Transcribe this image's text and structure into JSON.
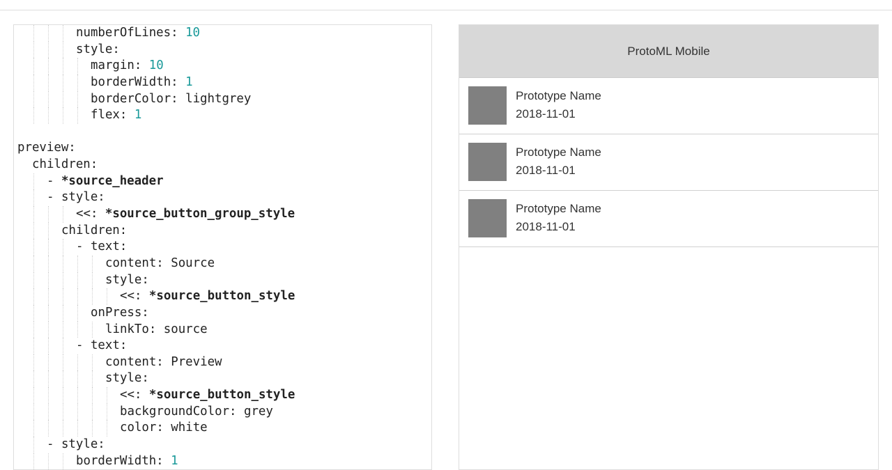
{
  "editor": {
    "lines": [
      {
        "indent": 4,
        "parts": [
          {
            "text": "numberOfLines: "
          },
          {
            "text": "10",
            "cls": "num"
          }
        ]
      },
      {
        "indent": 4,
        "parts": [
          {
            "text": "style:"
          }
        ]
      },
      {
        "indent": 5,
        "parts": [
          {
            "text": "margin: "
          },
          {
            "text": "10",
            "cls": "num"
          }
        ]
      },
      {
        "indent": 5,
        "parts": [
          {
            "text": "borderWidth: "
          },
          {
            "text": "1",
            "cls": "num"
          }
        ]
      },
      {
        "indent": 5,
        "parts": [
          {
            "text": "borderColor: lightgrey"
          }
        ]
      },
      {
        "indent": 5,
        "parts": [
          {
            "text": "flex: "
          },
          {
            "text": "1",
            "cls": "num"
          }
        ]
      },
      {
        "indent": 0,
        "parts": []
      },
      {
        "indent": 0,
        "parts": [
          {
            "text": "preview:"
          }
        ]
      },
      {
        "indent": 1,
        "parts": [
          {
            "text": "children:"
          }
        ]
      },
      {
        "indent": 2,
        "parts": [
          {
            "text": "- "
          },
          {
            "text": "*source_header",
            "cls": "bold"
          }
        ]
      },
      {
        "indent": 2,
        "parts": [
          {
            "text": "- style:"
          }
        ]
      },
      {
        "indent": 4,
        "parts": [
          {
            "text": "<<: "
          },
          {
            "text": "*source_button_group_style",
            "cls": "bold"
          }
        ]
      },
      {
        "indent": 3,
        "parts": [
          {
            "text": "children:"
          }
        ]
      },
      {
        "indent": 4,
        "parts": [
          {
            "text": "- text:"
          }
        ]
      },
      {
        "indent": 6,
        "parts": [
          {
            "text": "content: Source"
          }
        ]
      },
      {
        "indent": 6,
        "parts": [
          {
            "text": "style:"
          }
        ]
      },
      {
        "indent": 7,
        "parts": [
          {
            "text": "<<: "
          },
          {
            "text": "*source_button_style",
            "cls": "bold"
          }
        ]
      },
      {
        "indent": 5,
        "parts": [
          {
            "text": "onPress:"
          }
        ]
      },
      {
        "indent": 6,
        "parts": [
          {
            "text": "linkTo: source"
          }
        ]
      },
      {
        "indent": 4,
        "parts": [
          {
            "text": "- text:"
          }
        ]
      },
      {
        "indent": 6,
        "parts": [
          {
            "text": "content: Preview"
          }
        ]
      },
      {
        "indent": 6,
        "parts": [
          {
            "text": "style:"
          }
        ]
      },
      {
        "indent": 7,
        "parts": [
          {
            "text": "<<: "
          },
          {
            "text": "*source_button_style",
            "cls": "bold"
          }
        ]
      },
      {
        "indent": 7,
        "parts": [
          {
            "text": "backgroundColor: grey"
          }
        ]
      },
      {
        "indent": 7,
        "parts": [
          {
            "text": "color: white"
          }
        ]
      },
      {
        "indent": 2,
        "parts": [
          {
            "text": "- style:"
          }
        ]
      },
      {
        "indent": 4,
        "parts": [
          {
            "text": "borderWidth: "
          },
          {
            "text": "1",
            "cls": "num"
          }
        ]
      }
    ]
  },
  "preview": {
    "title": "ProtoML Mobile",
    "items": [
      {
        "name": "Prototype Name",
        "date": "2018-11-01"
      },
      {
        "name": "Prototype Name",
        "date": "2018-11-01"
      },
      {
        "name": "Prototype Name",
        "date": "2018-11-01"
      }
    ]
  },
  "colors": {
    "number": "#1a9a9a",
    "header_bg": "#d8d8d8",
    "thumbnail": "#808080"
  }
}
